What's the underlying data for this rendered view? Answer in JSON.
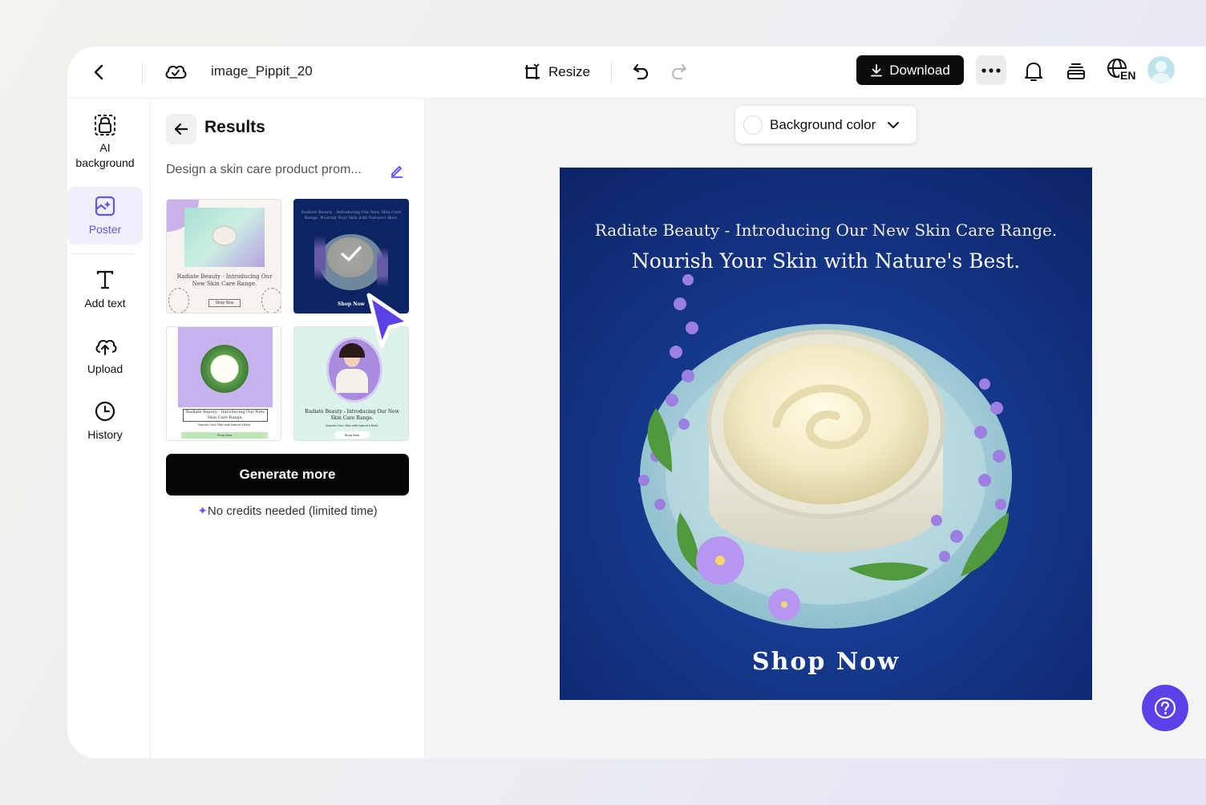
{
  "header": {
    "project_name": "image_Pippit_20",
    "resize_label": "Resize",
    "download_label": "Download",
    "language_code": "EN"
  },
  "rail": {
    "items": [
      {
        "label": "AI\nbackground",
        "icon": "ai-background-icon"
      },
      {
        "label": "Poster",
        "icon": "poster-icon",
        "active": true
      },
      {
        "label": "Add text",
        "icon": "text-icon"
      },
      {
        "label": "Upload",
        "icon": "upload-icon"
      },
      {
        "label": "History",
        "icon": "history-icon"
      }
    ]
  },
  "results": {
    "title": "Results",
    "prompt": "Design a skin care product prom...",
    "generate_label": "Generate more",
    "credits_note": "No credits needed (limited time)",
    "thumbnails": [
      {
        "text1": "Radiate Beauty - Introducing Our New Skin Care Range.",
        "cta": "Shop Now",
        "selected": false
      },
      {
        "text1": "Radiate Beauty - Introducing Our New Skin Care Range. Nourish Your Skin with Nature's Best.",
        "cta": "Shop Now",
        "selected": true
      },
      {
        "text1": "Radiate Beauty - Introducing Our New Skin Care Range.",
        "text2": "Nourish Your Skin with Nature's Best.",
        "cta": "Shop Now",
        "selected": false
      },
      {
        "text1": "Radiate Beauty - Introducing Our New Skin Care Range.",
        "text2": "Nourish Your Skin with Nature's Best.",
        "cta": "Shop Now",
        "selected": false
      }
    ]
  },
  "canvas": {
    "background_dropdown_label": "Background color",
    "poster": {
      "line1": "Radiate Beauty - Introducing Our New Skin Care Range.",
      "line2": "Nourish Your Skin with Nature's Best.",
      "cta": "Shop Now"
    }
  },
  "colors": {
    "accent": "#5b42e8",
    "poster_bg": "#16398e",
    "primary_button": "#050505"
  }
}
